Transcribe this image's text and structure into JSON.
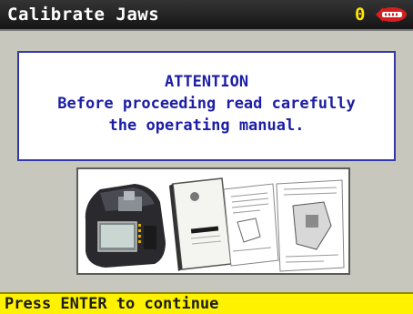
{
  "window": {
    "title": "Calibrate Jaws",
    "counter": "0",
    "logo_icon": "brand-logo-icon"
  },
  "message": {
    "heading": "ATTENTION",
    "line1": "Before proceeding read carefully",
    "line2": "the operating manual."
  },
  "illustration": {
    "icon": "machine-and-manual-illustration"
  },
  "status": {
    "prompt": "Press ENTER to continue"
  },
  "colors": {
    "titlebar": "#1e1e1e",
    "counter": "#ffe600",
    "message_text": "#1c1ea5",
    "message_border": "#3338a8",
    "statusbar": "#fff200",
    "background": "#c7c7bd"
  }
}
